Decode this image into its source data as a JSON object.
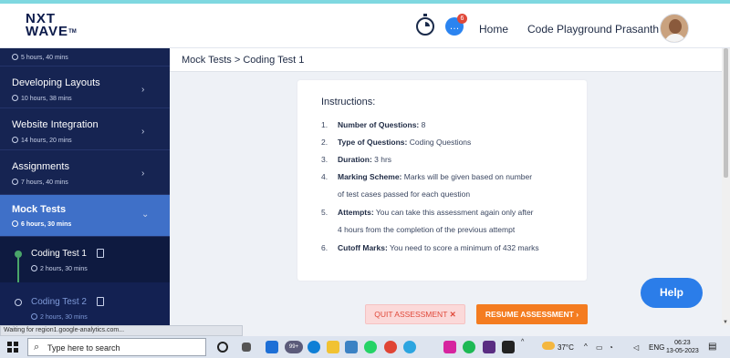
{
  "header": {
    "logo_line1": "NXT",
    "logo_line2": "WAVE",
    "logo_tm": "TM",
    "chat_badge": "6",
    "nav_home": "Home",
    "nav_code_playground": "Code Playground",
    "user_name": "Prasanth"
  },
  "sidebar": {
    "items": [
      {
        "title": "",
        "meta": "5 hours, 40 mins"
      },
      {
        "title": "Developing Layouts",
        "meta": "10 hours, 38 mins"
      },
      {
        "title": "Website Integration",
        "meta": "14 hours, 20 mins"
      },
      {
        "title": "Assignments",
        "meta": "7 hours, 40 mins"
      },
      {
        "title": "Mock Tests",
        "meta": "6 hours, 30 mins"
      }
    ],
    "sub_items": [
      {
        "title": "Coding Test 1",
        "meta": "2 hours, 30 mins"
      },
      {
        "title": "Coding Test 2",
        "meta": "2 hours, 30 mins"
      }
    ]
  },
  "breadcrumb": "Mock Tests > Coding Test 1",
  "instructions": {
    "title": "Instructions:",
    "items": [
      {
        "num": "1.",
        "label": "Number of Questions:",
        "text": " 8",
        "cont": ""
      },
      {
        "num": "2.",
        "label": "Type of Questions:",
        "text": " Coding Questions",
        "cont": ""
      },
      {
        "num": "3.",
        "label": "Duration:",
        "text": " 3 hrs",
        "cont": ""
      },
      {
        "num": "4.",
        "label": "Marking Scheme:",
        "text": " Marks will be given based on number",
        "cont": "of test cases passed for each question"
      },
      {
        "num": "5.",
        "label": "Attempts:",
        "text": " You can take this assessment again only after",
        "cont": "4 hours from the completion of the previous attempt"
      },
      {
        "num": "6.",
        "label": "Cutoff Marks:",
        "text": " You need to score a minimum of 432 marks",
        "cont": ""
      }
    ]
  },
  "buttons": {
    "quit": "QUIT ASSESSMENT",
    "quit_icon": "✕",
    "resume": "RESUME ASSESSMENT",
    "resume_icon": "›",
    "help": "Help"
  },
  "status_bar": "Waiting for region1.google-analytics.com...",
  "taskbar": {
    "search_placeholder": "Type here to search",
    "weather": "37°C",
    "lang": "ENG",
    "time": "06:23",
    "date": "13-05-2023",
    "badge": "99+"
  }
}
